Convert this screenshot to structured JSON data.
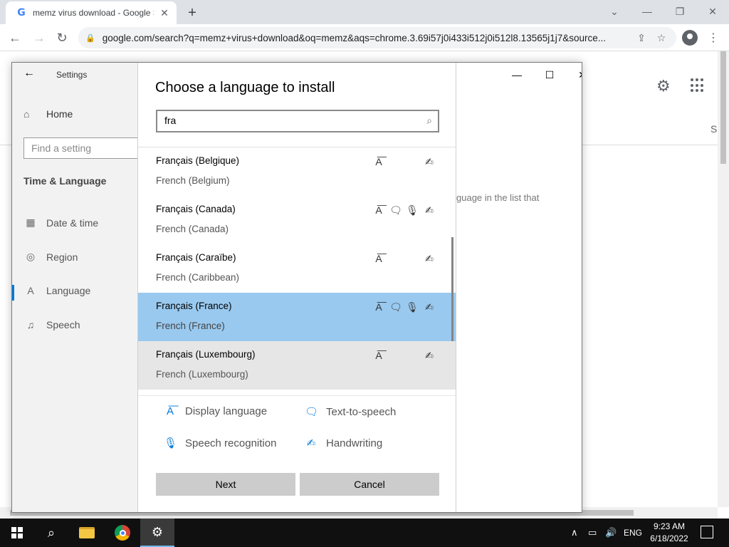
{
  "browser": {
    "tab_title": "memz virus download - Google S",
    "tab_close": "✕",
    "new_tab": "+",
    "url": "google.com/search?q=memz+virus+download&oq=memz&aqs=chrome.3.69i57j0i433i512j0i512l8.13565j1j7&source...",
    "controls": {
      "chevron": "⌄",
      "minimize": "—",
      "restore": "❐",
      "close": "✕"
    },
    "nav": {
      "back": "←",
      "forward": "→",
      "reload": "↻",
      "share": "⇪",
      "bookmark": "☆",
      "menu": "⋮"
    }
  },
  "google_page": {
    "gear": "⚙",
    "partial_tab": "S"
  },
  "settings": {
    "title": "Settings",
    "back": "←",
    "home_icon": "⌂",
    "home_label": "Home",
    "find_placeholder": "Find a setting",
    "section": "Time & Language",
    "nav": [
      {
        "icon": "▦",
        "label": "Date & time"
      },
      {
        "icon": "◎",
        "label": "Region"
      },
      {
        "icon": "A",
        "label": "Language"
      },
      {
        "icon": "♫",
        "label": "Speech"
      }
    ],
    "window_controls": {
      "minimize": "—",
      "maximize": "☐",
      "close": "✕"
    },
    "right_text": "guage in the list that"
  },
  "dialog": {
    "title": "Choose a language to install",
    "search_value": "fra",
    "search_icon": "⌕",
    "languages": [
      {
        "native": "Français (Belgique)",
        "english": "French (Belgium)"
      },
      {
        "native": "Français (Canada)",
        "english": "French (Canada)"
      },
      {
        "native": "Français (Caraïbe)",
        "english": "French (Caribbean)"
      },
      {
        "native": "Français (France)",
        "english": "French (France)"
      },
      {
        "native": "Français (Luxembourg)",
        "english": "French (Luxembourg)"
      }
    ],
    "feature_icons": {
      "display": "A͞",
      "tts": "🗨",
      "speech": "🎙",
      "handwriting": "✍"
    },
    "legend": {
      "display_language": "Display language",
      "text_to_speech": "Text-to-speech",
      "speech_recognition": "Speech recognition",
      "handwriting": "Handwriting"
    },
    "next_label": "Next",
    "cancel_label": "Cancel"
  },
  "taskbar": {
    "search": "⌕",
    "settings_gear": "⚙",
    "tray_up": "∧",
    "network": "▭",
    "volume": "🔊",
    "language": "ENG",
    "time": "9:23 AM",
    "date": "6/18/2022"
  }
}
